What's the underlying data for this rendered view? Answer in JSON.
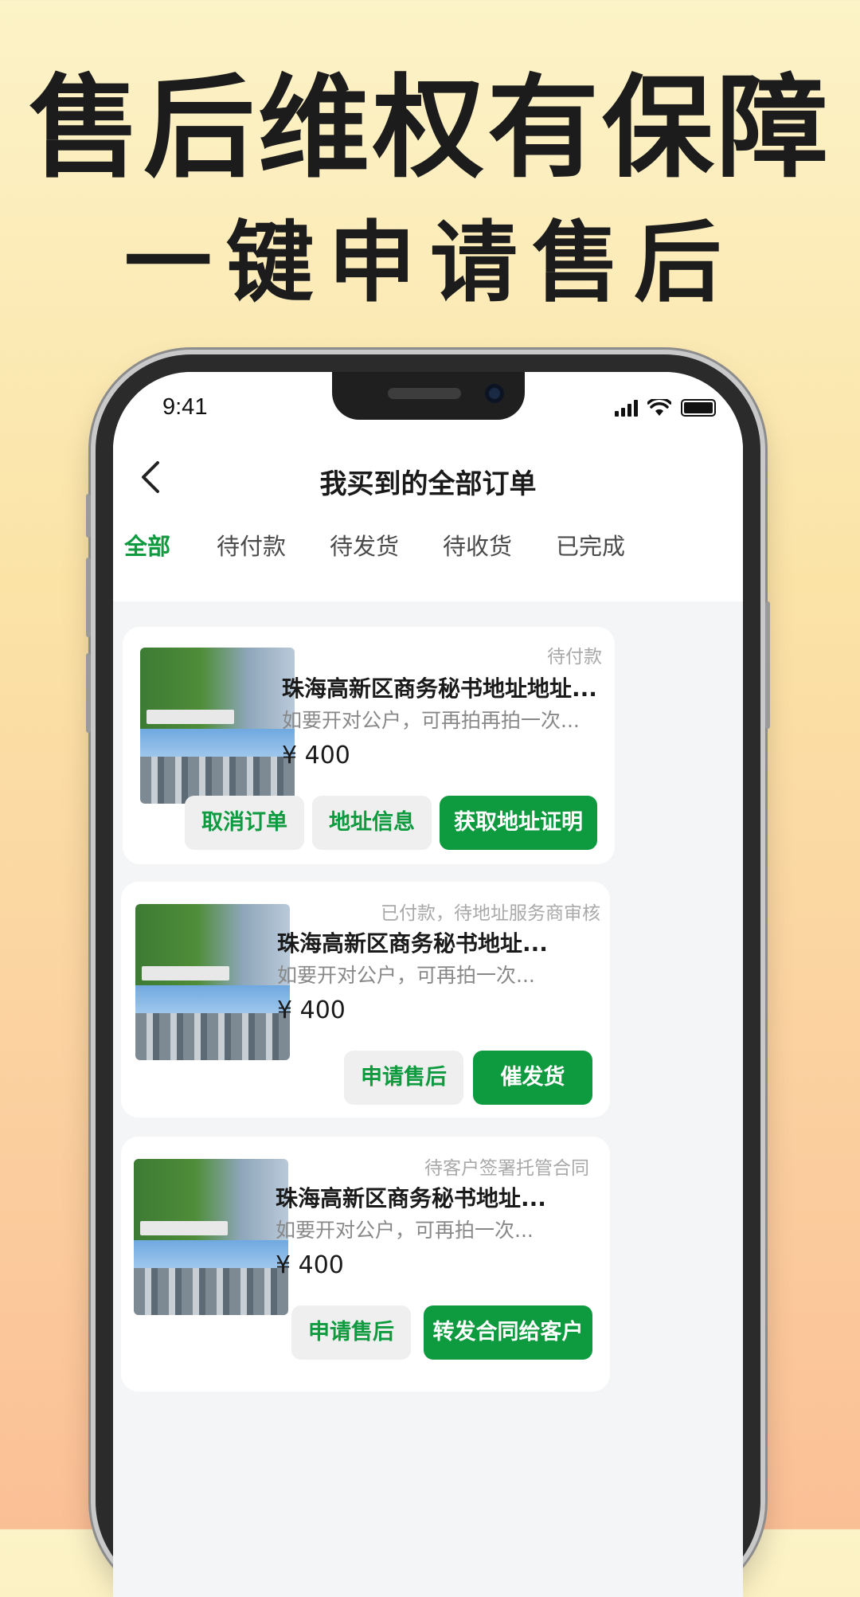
{
  "promo": {
    "headline": "售后维权有保障",
    "subheadline": "一键申请售后"
  },
  "status_bar": {
    "time": "9:41"
  },
  "nav": {
    "back_icon": "chevron-left-icon",
    "title": "我买到的全部订单"
  },
  "tabs": [
    "全部",
    "待付款",
    "待发货",
    "待收货",
    "已完成"
  ],
  "orders": [
    {
      "status": "待付款",
      "title": "珠海高新区商务秘书地址地址...",
      "desc": "如要开对公户，可再拍再拍一次...",
      "price": "¥ 400",
      "buttons": [
        "取消订单",
        "地址信息",
        "获取地址证明"
      ]
    },
    {
      "status": "已付款，待地址服务商审核",
      "title": "珠海高新区商务秘书地址...",
      "desc": "如要开对公户，可再拍一次...",
      "price": "¥ 400",
      "buttons": [
        "申请售后",
        "催发货"
      ]
    },
    {
      "status": "待客户签署托管合同",
      "title": "珠海高新区商务秘书地址...",
      "desc": "如要开对公户，可再拍一次...",
      "price": "¥ 400",
      "buttons": [
        "申请售后",
        "转发合同给客户"
      ]
    }
  ],
  "colors": {
    "accent": "#0e9a3e"
  }
}
